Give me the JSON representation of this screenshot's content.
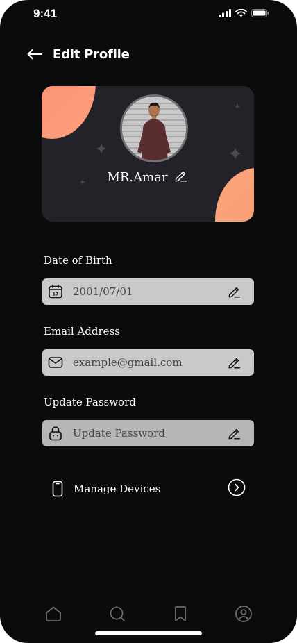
{
  "status_bar": {
    "time": "9:41"
  },
  "header": {
    "title": "Edit Profile"
  },
  "profile": {
    "name": "MR.Amar"
  },
  "fields": [
    {
      "label": "Date of Birth",
      "value": "2001/07/01",
      "icon": "calendar-icon",
      "bg": "#c9c9c9"
    },
    {
      "label": "Email Address",
      "value": "example@gmail.com",
      "icon": "mail-icon",
      "bg": "#c9c9c9"
    },
    {
      "label": "Update Password",
      "value": "Update Password",
      "icon": "lock-icon",
      "bg": "#b7b7b7"
    }
  ],
  "manage_devices": {
    "label": "Manage Devices",
    "icon": "phone-device-icon"
  },
  "bottom_nav": [
    {
      "name": "home-icon"
    },
    {
      "name": "search-icon"
    },
    {
      "name": "bookmark-icon"
    },
    {
      "name": "profile-icon"
    }
  ],
  "colors": {
    "background": "#0b0b0b",
    "card": "#222228",
    "accent_start": "#f9896d",
    "accent_end": "#fca07d"
  }
}
